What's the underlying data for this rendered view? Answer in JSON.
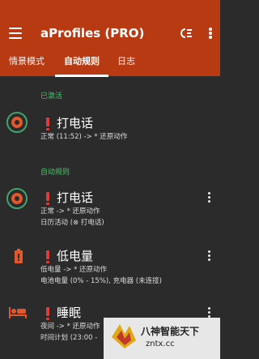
{
  "app": {
    "title": "aProfiles (PRO)",
    "icons": {
      "menu": "menu-icon",
      "sort": "sort-icon",
      "more": "more-vert-icon"
    }
  },
  "tabs": [
    {
      "label": "情景模式",
      "active": false
    },
    {
      "label": "自动规则",
      "active": true
    },
    {
      "label": "日志",
      "active": false
    }
  ],
  "sections": {
    "active": "已激活",
    "rules": "自动规则"
  },
  "active_profile": {
    "title": "打电话",
    "line1": "正常 (11:52) -> * 还原动作",
    "icon": "profile-status-icon"
  },
  "rules": [
    {
      "title": "打电话",
      "line1": "正常 -> * 还原动作",
      "line2": "日历活动 (⊗ 打电话)",
      "icon": "profile-status-icon"
    },
    {
      "title": "低电量",
      "line1": "低电量 -> * 还原动作",
      "line2": "电池电量 (0% - 15%), 充电器 (未连接)",
      "icon": "battery-icon"
    },
    {
      "title": "睡眠",
      "line1": "夜间 -> * 还原动作",
      "line2": "时间计划 (23:00 -",
      "icon": "bed-icon"
    }
  ],
  "watermark": {
    "text": "八神智能天下",
    "url": "zntx.cc"
  },
  "colors": {
    "appbar": "#b83a13",
    "background": "#2b2b2b",
    "section": "#4cc06a",
    "warning": "#e53935",
    "accent": "#e2572c",
    "ring": "#3fa56a"
  }
}
